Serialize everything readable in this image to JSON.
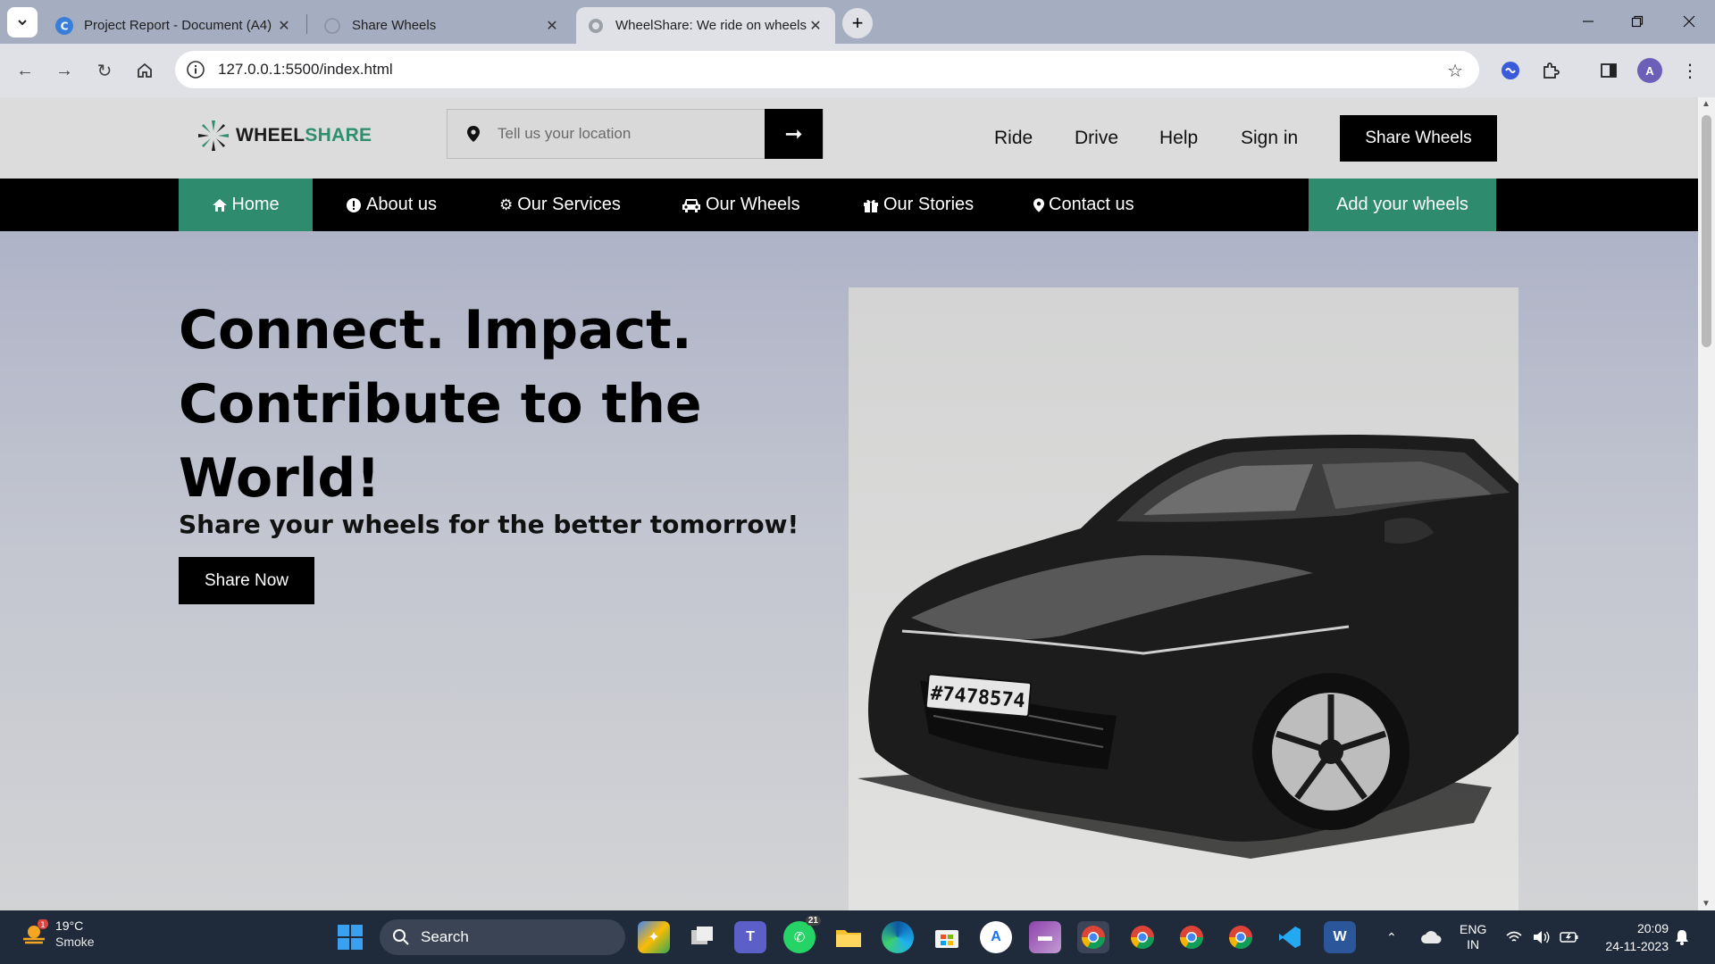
{
  "browser": {
    "tabs": [
      {
        "title": "Project Report - Document (A4)",
        "active": false
      },
      {
        "title": "Share Wheels",
        "active": false
      },
      {
        "title": "WheelShare: We ride on wheels",
        "active": true
      }
    ],
    "url": "127.0.0.1:5500/index.html"
  },
  "site": {
    "logo": {
      "part1": "WHEEL",
      "part2": "SHARE"
    },
    "location_placeholder": "Tell us your location",
    "top_links": [
      "Ride",
      "Drive",
      "Help",
      "Sign in"
    ],
    "share_wheels_button": "Share Wheels",
    "nav": {
      "home": "Home",
      "about": "About us",
      "services": "Our Services",
      "wheels": "Our Wheels",
      "stories": "Our Stories",
      "contact": "Contact us",
      "add_wheels": "Add your wheels"
    },
    "hero": {
      "title_lines": [
        "Connect. Impact.",
        "Contribute to the",
        "World!"
      ],
      "subtitle": "Share your wheels for the better tomorrow!",
      "cta": "Share Now",
      "plate": "#7478574"
    },
    "colors": {
      "accent": "#2e8b6d",
      "dark": "#000000"
    }
  },
  "taskbar": {
    "weather": {
      "temp": "19°C",
      "condition": "Smoke",
      "badge": "1"
    },
    "search_label": "Search",
    "whatsapp_badge": "21",
    "tray": {
      "lang": "ENG",
      "region": "IN"
    },
    "clock": {
      "time": "20:09",
      "date": "24-11-2023"
    }
  }
}
